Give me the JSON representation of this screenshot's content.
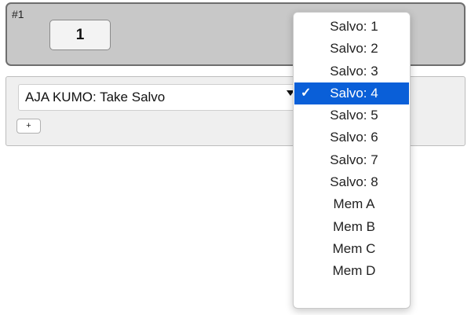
{
  "bank": {
    "number_label": "#1",
    "step_value": "1"
  },
  "action": {
    "selected_action": "AJA KUMO: Take Salvo",
    "add_label": "+"
  },
  "dropdown": {
    "check_mark": "✓",
    "selected_index": 3,
    "items": [
      {
        "label": "Salvo: 1"
      },
      {
        "label": "Salvo: 2"
      },
      {
        "label": "Salvo: 3"
      },
      {
        "label": "Salvo: 4"
      },
      {
        "label": "Salvo: 5"
      },
      {
        "label": "Salvo: 6"
      },
      {
        "label": "Salvo: 7"
      },
      {
        "label": "Salvo: 8"
      },
      {
        "label": "Mem A"
      },
      {
        "label": "Mem B"
      },
      {
        "label": "Mem C"
      },
      {
        "label": "Mem D"
      }
    ]
  },
  "colors": {
    "selection_highlight": "#0a5fd8",
    "panel_background": "#c8c8c8"
  }
}
